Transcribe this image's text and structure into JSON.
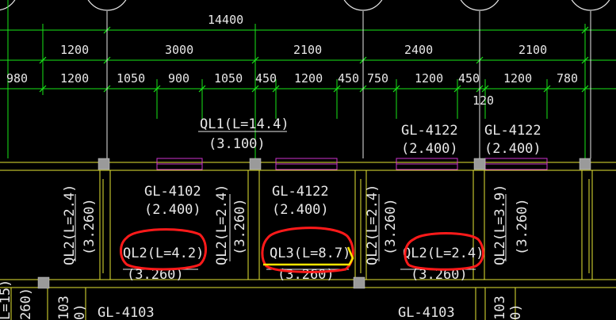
{
  "dimensions": {
    "overall": "14400",
    "row1": [
      "1200",
      "3000",
      "2100",
      "2400",
      "2100"
    ],
    "row2": [
      "980",
      "1200",
      "1050",
      "900",
      "1050",
      "450",
      "1200",
      "450",
      "750",
      "1200",
      "450",
      "1200",
      "780"
    ],
    "extra": "120"
  },
  "beams": {
    "ql1": {
      "name": "QL1(L=14.4)",
      "elev": "(3.100)"
    },
    "gl_top_1": {
      "name": "GL-4122",
      "elev": "(2.400)"
    },
    "gl_top_2": {
      "name": "GL-4122",
      "elev": "(2.400)"
    },
    "gl_4102": {
      "name": "GL-4102",
      "elev": "(2.400)"
    },
    "gl_4122_mid": {
      "name": "GL-4122",
      "elev": "(2.400)"
    },
    "ql2_left": {
      "name": "QL2(L=2.4)",
      "elev": "(3.260)"
    },
    "ql2_a": {
      "name": "QL2(L=2.4)",
      "elev": "(3.260)"
    },
    "ql2_b": {
      "name": "QL2(L=2.4)",
      "elev": "(3.260)"
    },
    "ql2_c": {
      "name": "QL2(L=3.9)",
      "elev": "(3.260)"
    },
    "ql2_h1": {
      "name": "QL2(L=4.2)",
      "elev": "(3.260)"
    },
    "ql3_h": {
      "name": "QL3(L=8.7)",
      "elev": "(3.260)"
    },
    "ql2_h2": {
      "name": "QL2(L=2.4)",
      "elev": "(3.260)"
    },
    "gl_4103_a": "GL-4103",
    "gl_4103_b": "GL-4103",
    "frag_left": "L=15)",
    "frag_left2": "260)",
    "frag_103_a": "103",
    "frag_103_b": "103",
    "frag_0a": "0)",
    "frag_0b": "0)"
  },
  "colors": {
    "background": "#000000",
    "dimension_line": "#19e619",
    "beam": "#e6e633",
    "text": "#e8e8e8",
    "window": "#cc33cc",
    "markup": "#ff1a1a",
    "column": "#9a9a9a"
  }
}
